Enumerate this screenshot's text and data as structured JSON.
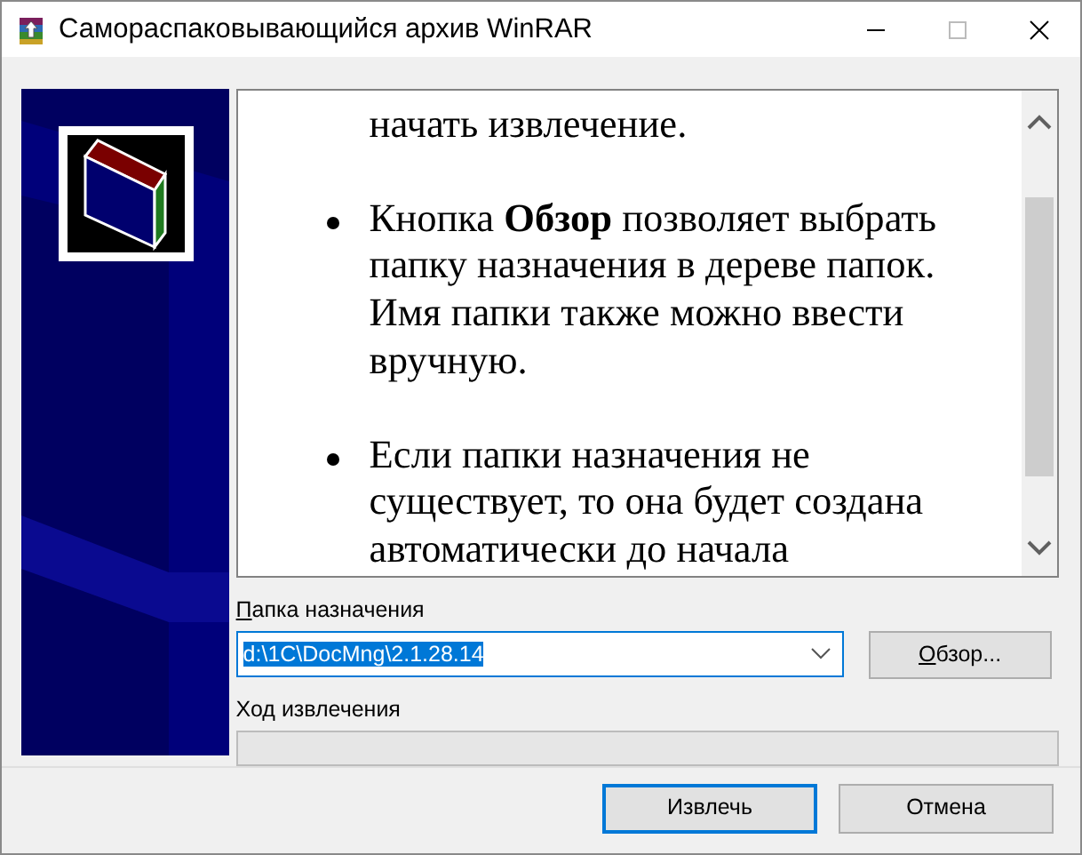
{
  "window": {
    "title": "Самораспаковывающийся архив WinRAR"
  },
  "info_text": [
    {
      "kind": "continuation",
      "text": "начать извлечение."
    },
    {
      "kind": "bullet",
      "text": "Кнопка **Обзор** позволяет выбрать папку назначения в дереве папок. Имя папки также можно ввести вручную."
    },
    {
      "kind": "bullet",
      "text": "Если папки назначения не существует, то она будет создана автоматически до начала"
    }
  ],
  "destination": {
    "label": "Папка назначения",
    "value": "d:\\1C\\DocMng\\2.1.28.14",
    "selected": true
  },
  "browse_button": {
    "label": "Обзор..."
  },
  "progress": {
    "label": "Ход извлечения",
    "level": 0
  },
  "buttons": [
    {
      "label": "Извлечь",
      "default": true
    },
    {
      "label": "Отмена",
      "default": false
    }
  ]
}
